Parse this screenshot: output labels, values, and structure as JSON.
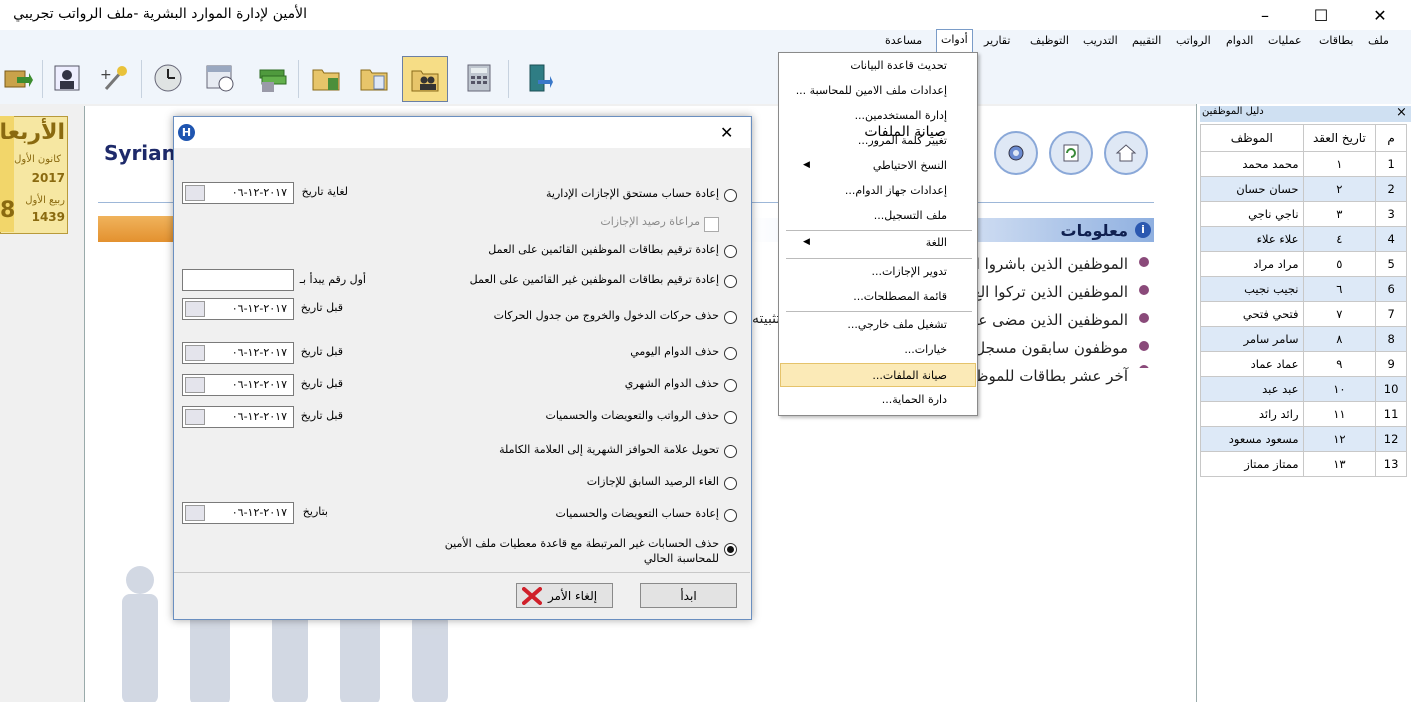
{
  "app": {
    "title": "الأمين لإدارة الموارد البشرية -ملف الرواتب تجريبي",
    "window_controls": {
      "minimize": "–",
      "maximize": "☐",
      "close": "✕"
    }
  },
  "menubar": {
    "items": [
      "ملف",
      "بطاقات",
      "عمليات",
      "الدوام",
      "الرواتب",
      "التقييم",
      "التدريب",
      "التوظيف",
      "تقارير",
      "أدوات",
      "مساعدة"
    ],
    "active": "أدوات"
  },
  "tools_menu": {
    "items": [
      "تحديث قاعدة البيانات",
      "إعدادات ملف الامين للمحاسبة ...",
      "إدارة المستخدمين...",
      "تغيير كلمة المرور...",
      "النسخ الاحتياطي",
      "إعدادات جهاز الدوام...",
      "ملف التسجيل...",
      "اللغة",
      "تدوير الإجازات...",
      "قائمة المصطلحات...",
      "تشغيل ملف خارجي...",
      "خيارات...",
      "صيانة الملفات...",
      "دارة الحماية..."
    ],
    "highlighted": "صيانة الملفات...",
    "submenu_arrow": "◀"
  },
  "background": {
    "brand": "Syrian",
    "calendar": {
      "day": "الأربعاء",
      "gregorian_month": "كانون الأول",
      "gregorian_year": "2017",
      "day_number": "8",
      "hijri_month": "ربيع الأول",
      "hijri_year": "1439"
    },
    "info_title": "معلومات",
    "info_links": [
      "الموظفين الذين باشروا ال",
      "الموظفين الذين تركوا الع",
      "الموظفين الذين مضى عل",
      "موظفون سابقون مسجل",
      "آخر عشر بطاقات للموظ"
    ],
    "partial_text": "تثبيته"
  },
  "employee_panel": {
    "title": "دليل الموظفين",
    "close": "×",
    "columns": [
      "م",
      "تاريخ العقد",
      "الموظف"
    ],
    "rows": [
      [
        "1",
        "١",
        "محمد محمد"
      ],
      [
        "2",
        "٢",
        "حسان حسان"
      ],
      [
        "3",
        "٣",
        "ناجي ناجي"
      ],
      [
        "4",
        "٤",
        "علاء علاء"
      ],
      [
        "5",
        "٥",
        "مراد مراد"
      ],
      [
        "6",
        "٦",
        "نجيب نجيب"
      ],
      [
        "7",
        "٧",
        "فتحي فتحي"
      ],
      [
        "8",
        "٨",
        "سامر سامر"
      ],
      [
        "9",
        "٩",
        "عماد عماد"
      ],
      [
        "10",
        "١٠",
        "عبد عبد"
      ],
      [
        "11",
        "١١",
        "رائد رائد"
      ],
      [
        "12",
        "١٢",
        "مسعود مسعود"
      ],
      [
        "13",
        "١٣",
        "ممتاز ممتاز"
      ]
    ]
  },
  "dialog": {
    "title": "صيانة الملفات",
    "close": "✕",
    "options": [
      "إعادة حساب مستحق الإجازات الإدارية",
      "إعادة ترقيم بطاقات الموظفين القائمين على العمل",
      "إعادة ترقيم بطاقات الموظفين غير القائمين على العمل",
      "حذف حركات الدخول والخروج من جدول الحركات",
      "حذف الدوام اليومي",
      "حذف الدوام الشهري",
      "حذف الرواتب والتعويضات والحسميات",
      "تحويل علامة الحوافز الشهرية إلى العلامة الكاملة",
      "الغاء الرصيد السابق للإجازات",
      "إعادة حساب التعويضات والحسميات",
      "حذف الحسابات غير المرتبطة مع قاعدة معطيات ملف الأمين للمحاسبة الحالي"
    ],
    "selected_option": 10,
    "checkbox_label": "مراعاة رصيد الإجازات",
    "fields": {
      "until_date_label": "لغاية تاريخ",
      "first_number_label": "أول رقم يبدأ بـ",
      "before_date_label": "قبل تاريخ",
      "at_date_label": "بتاريخ",
      "date_value": "٢٠١٧-١٢-٠٦"
    },
    "buttons": {
      "start": "ابدأ",
      "cancel": "إلغاء الأمر"
    }
  },
  "colors": {
    "menu_bg": "#f0f5fb",
    "highlight": "#fbeab7",
    "dialog_border": "#6a8fc0",
    "table_alt": "#dde9f7"
  }
}
